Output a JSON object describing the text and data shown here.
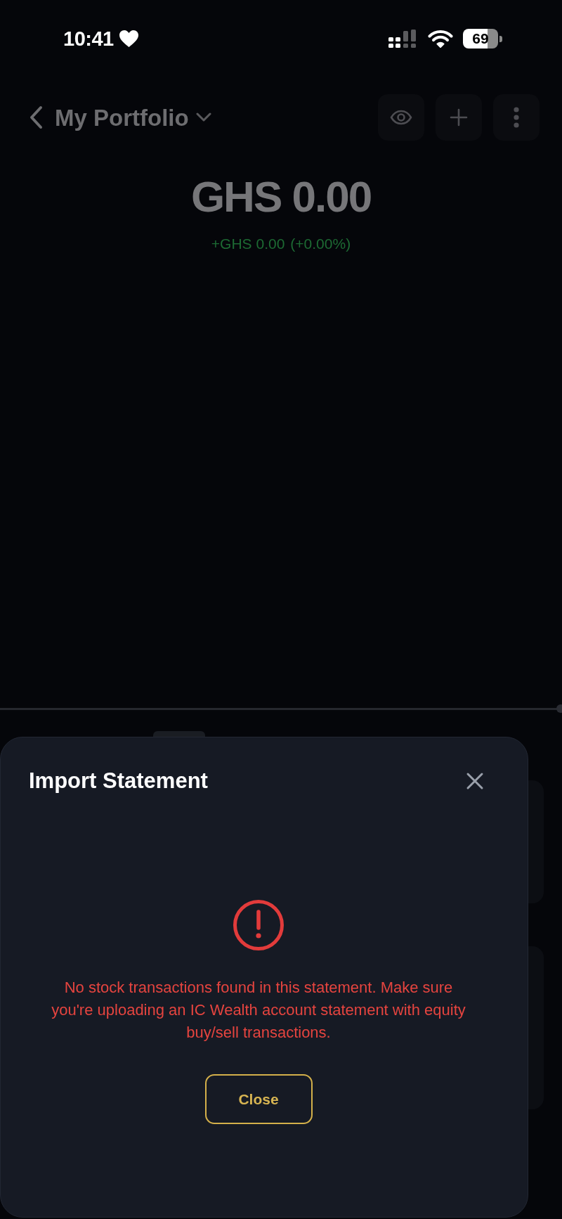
{
  "status_bar": {
    "time": "10:41",
    "battery": "69"
  },
  "header": {
    "title": "My Portfolio"
  },
  "balance": {
    "amount": "GHS 0.00",
    "change": "+GHS 0.00",
    "change_percent": "(+0.00%)"
  },
  "dialog": {
    "title": "Import Statement",
    "message": "No stock transactions found in this statement. Make sure you're uploading an IC Wealth account statement with equity buy/sell transactions.",
    "button": "Close"
  }
}
